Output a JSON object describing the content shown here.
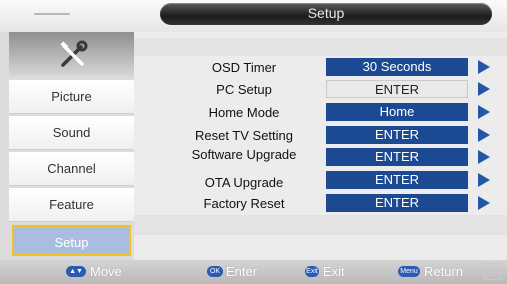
{
  "header": {
    "title": "Setup"
  },
  "sidebar": {
    "tools_icon": "tools-icon",
    "items": [
      {
        "label": "Picture"
      },
      {
        "label": "Sound"
      },
      {
        "label": "Channel"
      },
      {
        "label": "Feature"
      },
      {
        "label": "Setup",
        "selected": true
      }
    ]
  },
  "settings": {
    "rows": [
      {
        "label": "OSD Timer",
        "value": "30 Seconds"
      },
      {
        "label": "PC Setup",
        "value": "ENTER",
        "style": "disabled"
      },
      {
        "label": "Home Mode",
        "value": "Home"
      },
      {
        "label": "Reset TV Setting",
        "value": "ENTER"
      },
      {
        "label": "Software Upgrade",
        "value": "ENTER"
      },
      {
        "label": "OTA  Upgrade",
        "value": "ENTER"
      },
      {
        "label": "Factory Reset",
        "value": "ENTER"
      }
    ]
  },
  "footer": {
    "hints": [
      {
        "key": "▲▼",
        "label": "Move"
      },
      {
        "key": "OK",
        "label": "Enter"
      },
      {
        "key": "Exit",
        "label": "Exit"
      },
      {
        "key": "Menu",
        "label": "Return"
      }
    ]
  },
  "colors": {
    "value_fill": "#1b4a92",
    "arrow": "#2357a6",
    "selected_fill": "#a9bde0",
    "selected_border": "#f3c21b"
  }
}
